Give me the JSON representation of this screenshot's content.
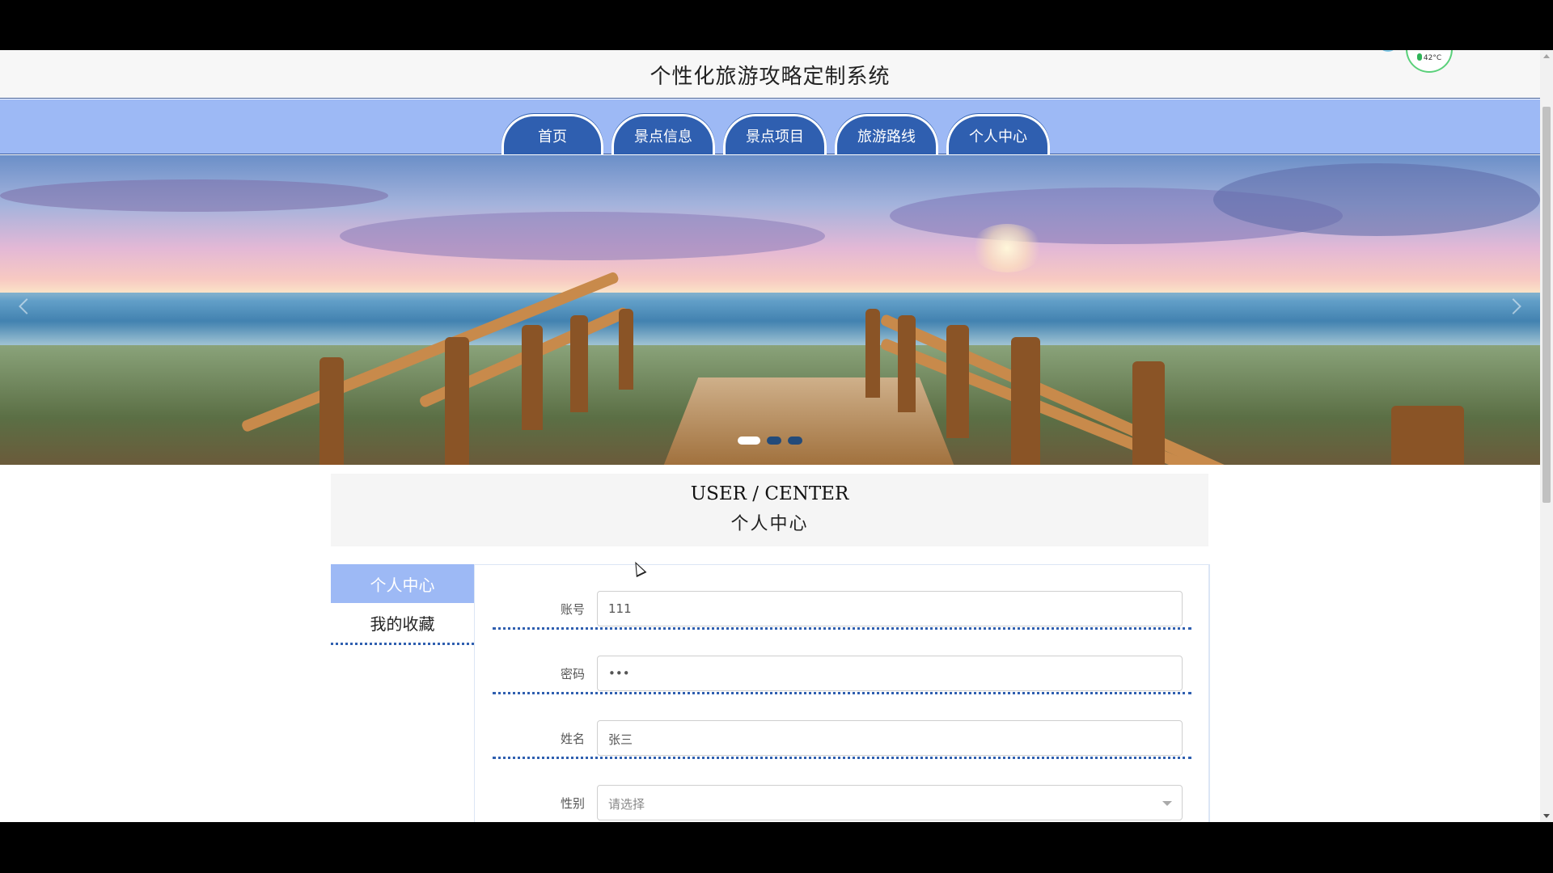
{
  "header": {
    "site_title": "个性化旅游攻略定制系统",
    "temp_widget": "42°C"
  },
  "nav": {
    "items": [
      {
        "label": "首页"
      },
      {
        "label": "景点信息"
      },
      {
        "label": "景点项目"
      },
      {
        "label": "旅游路线"
      },
      {
        "label": "个人中心"
      }
    ]
  },
  "banner": {
    "slides_count": 3,
    "active_slide": 1
  },
  "user_center": {
    "title_en": "USER / CENTER",
    "title_cn": "个人中心"
  },
  "sidebar": {
    "items": [
      {
        "label": "个人中心",
        "active": true
      },
      {
        "label": "我的收藏",
        "active": false
      }
    ]
  },
  "form": {
    "account_label": "账号",
    "account_value": "111",
    "password_label": "密码",
    "password_value": "•••",
    "name_label": "姓名",
    "name_value": "张三",
    "gender_label": "性别",
    "gender_placeholder": "请选择"
  },
  "colors": {
    "nav_bg": "#9db9f5",
    "nav_tab": "#2f5fb0",
    "accent_dotted": "#2f5fb0"
  }
}
